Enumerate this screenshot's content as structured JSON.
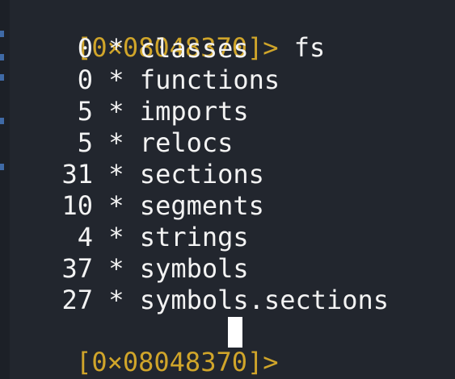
{
  "prompt": "[0×08048370]>",
  "command": "fs",
  "entries": [
    {
      "count": "0",
      "marker": "*",
      "name": "classes"
    },
    {
      "count": "0",
      "marker": "*",
      "name": "functions"
    },
    {
      "count": "5",
      "marker": "*",
      "name": "imports"
    },
    {
      "count": "5",
      "marker": "*",
      "name": "relocs"
    },
    {
      "count": "31",
      "marker": "*",
      "name": "sections"
    },
    {
      "count": "10",
      "marker": "*",
      "name": "segments"
    },
    {
      "count": "4",
      "marker": "*",
      "name": "strings"
    },
    {
      "count": "37",
      "marker": "*",
      "name": "symbols"
    },
    {
      "count": "27",
      "marker": "*",
      "name": "symbols.sections"
    }
  ],
  "colors": {
    "background": "#22262e",
    "prompt": "#d0a52a",
    "text": "#f3f3f3",
    "cursor": "#ffffff"
  }
}
